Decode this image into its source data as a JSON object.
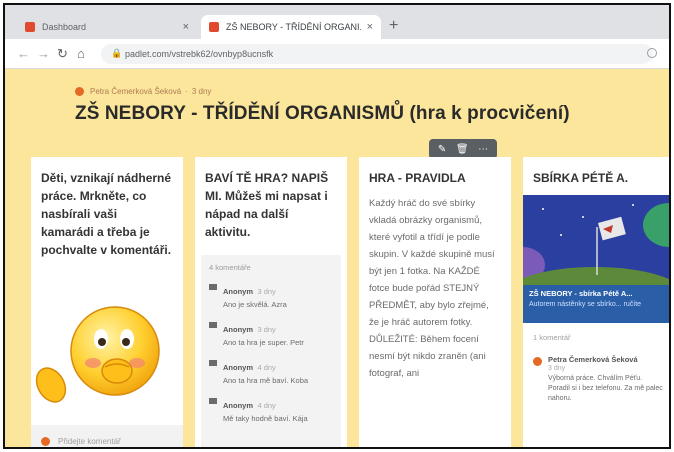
{
  "browser": {
    "tabs": [
      {
        "title": "Dashboard",
        "close": "×"
      },
      {
        "title": "ZŠ NEBORY - TŘÍDĚNÍ ORGANI...",
        "close": "×"
      }
    ],
    "new_tab": "+",
    "url": "padlet.com/vstrebk62/ovnbyp8ucnsfk"
  },
  "padlet": {
    "author": "Petra Čemerková Šeková",
    "author_time": "3 dny",
    "title": "ZŠ NEBORY - TŘÍDĚNÍ ORGANISMŮ (hra k procvičení)",
    "tools": [
      "✎",
      "🗑",
      "⋯"
    ]
  },
  "cards": {
    "c1": {
      "title": "Děti, vznikají nádherné práce. Mrkněte, co nasbírali vaši kamarádi a třeba je pochvalte v komentáři.",
      "add_comment": "Přidejte komentář"
    },
    "c2": {
      "title": "BAVÍ TĚ HRA? NAPIŠ MI. Můžeš mi napsat i nápad na další aktivitu.",
      "comment_count": "4 komentáře",
      "comments": [
        {
          "author": "Anonym",
          "time": "3 dny",
          "text": "Ano je skvělá. Azra"
        },
        {
          "author": "Anonym",
          "time": "3 dny",
          "text": "Ano ta hra je super. Petr"
        },
        {
          "author": "Anonym",
          "time": "4 dny",
          "text": "Ano ta hra mě baví. Koba"
        },
        {
          "author": "Anonym",
          "time": "4 dny",
          "text": "Mě taky hodně baví. Kája"
        }
      ]
    },
    "c3": {
      "title": "HRA - PRAVIDLA",
      "body": "Každý hráč do své sbírky vkladá obrázky organismů, které vyfotil a třídí je podle skupin. V každé skupině musí být jen 1 fotka. Na KAŽDÉ fotce bude pořád STEJNÝ PŘEDMĚT, aby bylo zřejmé, že je hráč autorem fotky. DŮLEŽITÉ: Během focení nesmí být nikdo zraněn (ani fotograf, ani"
    },
    "c4": {
      "title": "SBÍRKA PÉTĚ A.",
      "link_title": "ZŠ NEBORY - sbírka Pétě A...",
      "link_sub": "Autorem nástěnky se sbírko... ručíte",
      "comment_count": "1 komentář",
      "comment": {
        "author": "Petra Čemerková Šeková",
        "time": "3 dny",
        "text": "Výborná práce. Chválím Péťu. Poradil si i bez telefonu. Za mě palec nahoru."
      }
    }
  },
  "colors": {
    "background": "#fbe69b",
    "accent": "#e46a24",
    "card": "#ffffff"
  }
}
